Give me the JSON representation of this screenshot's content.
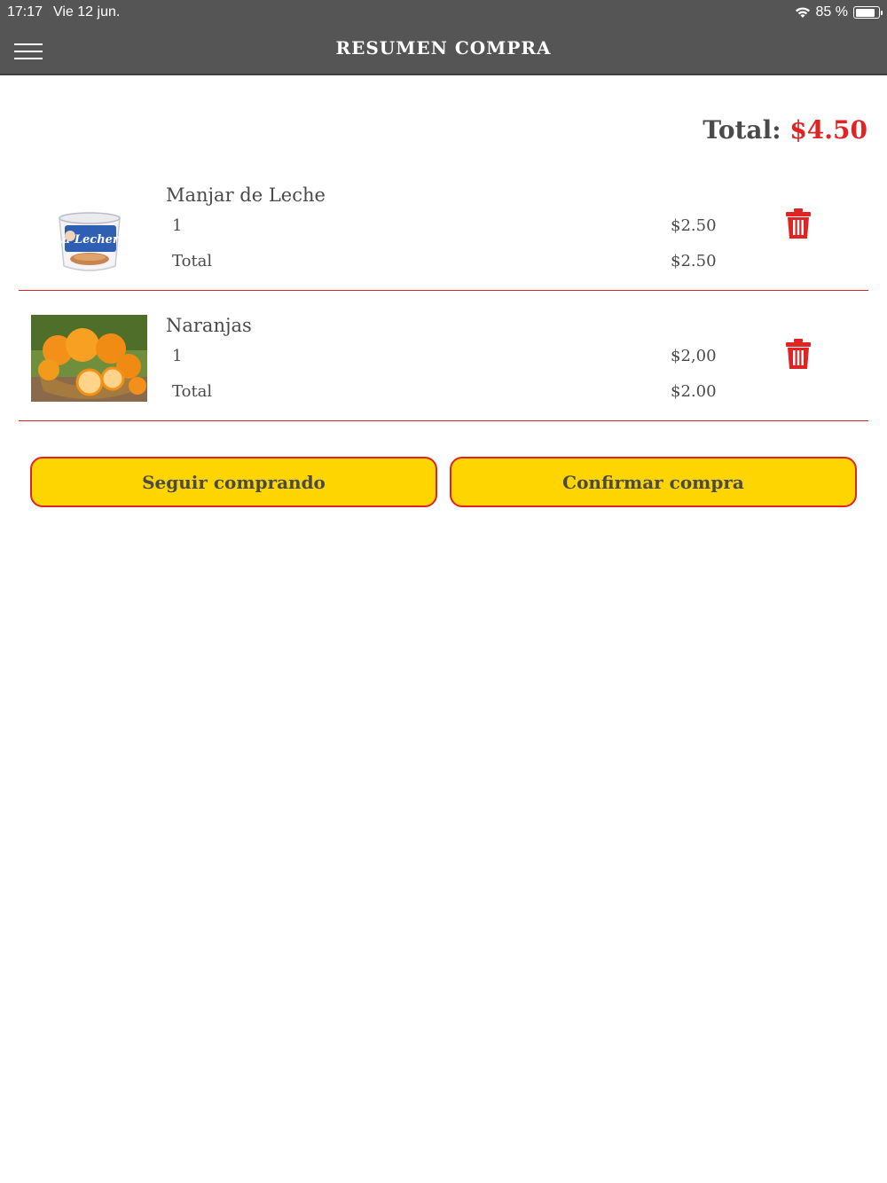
{
  "status_bar": {
    "time": "17:17",
    "date": "Vie 12 jun.",
    "battery": "85 %",
    "battery_level": 0.85
  },
  "header": {
    "title": "RESUMEN COMPRA",
    "menu_icon": "hamburger-icon"
  },
  "summary": {
    "total_label": "Total:",
    "total_value": "$4.50"
  },
  "items": [
    {
      "name": "Manjar de Leche",
      "quantity": "1",
      "unit_price": "$2.50",
      "total_label": "Total",
      "total_value": "$2.50",
      "image_label": "La Lechera",
      "delete_icon": "trash-icon"
    },
    {
      "name": "Naranjas",
      "quantity": "1",
      "unit_price": "$2,00",
      "total_label": "Total",
      "total_value": "$2.00",
      "delete_icon": "trash-icon"
    }
  ],
  "actions": {
    "continue_label": "Seguir comprando",
    "confirm_label": "Confirmar compra"
  },
  "colors": {
    "header_bg": "#555555",
    "accent_red": "#e02424",
    "button_yellow": "#ffd500",
    "text_gray": "#4a4a4a"
  }
}
